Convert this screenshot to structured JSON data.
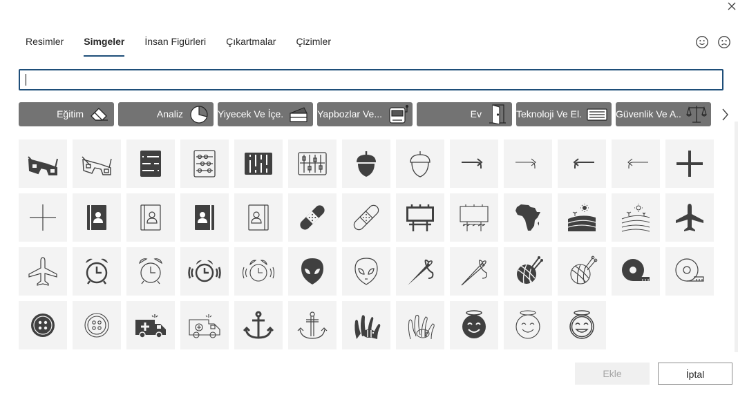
{
  "tabs": [
    "Resimler",
    "Simgeler",
    "İnsan Figürleri",
    "Çıkartmalar",
    "Çizimler"
  ],
  "active_tab": "Simgeler",
  "search": {
    "value": "",
    "placeholder": ""
  },
  "categories": [
    {
      "label": "Eğitim",
      "icon": "eraser-icon"
    },
    {
      "label": "Analiz",
      "icon": "pie-chart-icon"
    },
    {
      "label": "Yiyecek Ve İçe...",
      "icon": "cake-icon"
    },
    {
      "label": "Yapbozlar Ve...",
      "icon": "slot-machine-icon"
    },
    {
      "label": "Ev",
      "icon": "door-icon"
    },
    {
      "label": "Teknoloji Ve El...",
      "icon": "keyboard-icon"
    },
    {
      "label": "Güvenlik Ve A...",
      "icon": "scales-icon"
    }
  ],
  "icons": [
    "3d-glasses-icon",
    "3d-glasses-outline-icon",
    "abacus-icon",
    "abacus-outline-icon",
    "abacus-wide-icon",
    "abacus-wide-outline-icon",
    "acorn-icon",
    "acorn-outline-icon",
    "turn-right-arrow-icon",
    "turn-right-arrow-outline-icon",
    "turn-left-arrow-icon",
    "turn-left-arrow-outline-icon",
    "plus-icon",
    "plus-outline-icon",
    "address-book-icon",
    "address-book-outline-icon",
    "address-book-alt-icon",
    "address-book-alt-outline-icon",
    "bandage-icon",
    "bandage-outline-icon",
    "billboard-icon",
    "billboard-outline-icon",
    "africa-icon",
    "farm-field-icon",
    "farm-field-outline-icon",
    "airplane-icon",
    "airplane-outline-icon",
    "alarm-clock-icon",
    "alarm-clock-outline-icon",
    "alarm-ringing-icon",
    "alarm-ringing-outline-icon",
    "alien-icon",
    "alien-outline-icon",
    "needle-icon",
    "needle-outline-icon",
    "yarn-ball-icon",
    "yarn-ball-outline-icon",
    "tape-measure-icon",
    "tape-measure-outline-icon",
    "button-icon",
    "button-outline-icon",
    "ambulance-icon",
    "ambulance-outline-icon",
    "anchor-icon",
    "anchor-outline-icon",
    "anemone-fish-icon",
    "anemone-fish-outline-icon",
    "angel-face-icon",
    "angel-face-outline-icon",
    "angel-face-alt-outline-icon"
  ],
  "buttons": {
    "insert": "Ekle",
    "cancel": "İptal"
  },
  "colors": {
    "accent": "#1e4e79",
    "category_bg": "#737373",
    "tile_bg": "#f3f3f3",
    "icon_dark": "#404040"
  }
}
